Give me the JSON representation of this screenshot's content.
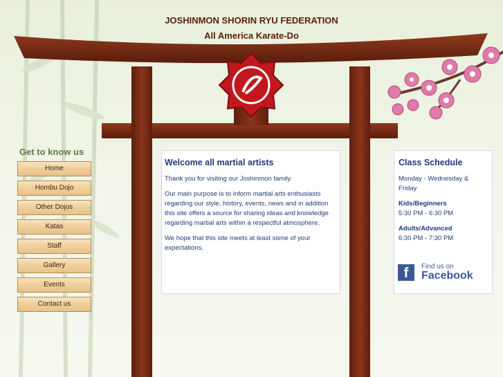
{
  "header": {
    "title": "JOSHINMON SHORIN RYU FEDERATION",
    "subtitle": "All America Karate-Do"
  },
  "nav": {
    "heading": "Get to know us",
    "items": [
      {
        "label": "Home"
      },
      {
        "label": "Hombu Dojo"
      },
      {
        "label": "Other Dojos"
      },
      {
        "label": "Katas"
      },
      {
        "label": "Staff"
      },
      {
        "label": "Gallery"
      },
      {
        "label": "Events"
      },
      {
        "label": "Contact us"
      }
    ]
  },
  "main": {
    "title": "Welcome all martial artists",
    "paragraphs": [
      "Thank you for visiting our Joshinmon family.",
      "Our main purpose is to inform martial arts enthusiasts regarding our style, history, events, news and in addition this site offers a source for sharing ideas and knowledge regarding martial arts within a respectful atmosphere.",
      "We hope that this site meets at least some of your expectations."
    ]
  },
  "schedule": {
    "title": "Class Schedule",
    "days": "Monday - Wednesday & Friday",
    "groups": [
      {
        "label": "Kids/Beginners",
        "time": "5:30 PM - 6:30 PM"
      },
      {
        "label": "Adults/Advanced",
        "time": "6:30 PM - 7:30 PM"
      }
    ],
    "facebook": {
      "small": "Find us on",
      "big": "Facebook"
    }
  },
  "colors": {
    "wood": "#7a2a14",
    "accent": "#1f3a7a",
    "emblem": "#c0181e"
  }
}
